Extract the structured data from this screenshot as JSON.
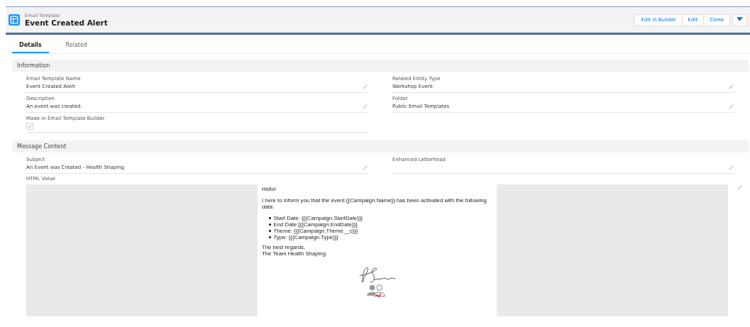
{
  "header": {
    "object_type": "Email Template",
    "title": "Event Created Alert",
    "actions": [
      "Edit in Builder",
      "Edit",
      "Clone"
    ]
  },
  "tabs": [
    {
      "label": "Details",
      "selected": true
    },
    {
      "label": "Related",
      "selected": false
    }
  ],
  "sections": [
    {
      "title": "Information",
      "fields": [
        {
          "label": "Email Template Name",
          "value": "Event Created Alert",
          "kind": "text",
          "editable": true
        },
        {
          "label": "Related Entity Type",
          "value": "Workshop Event",
          "kind": "text",
          "editable": true
        },
        {
          "label": "Description",
          "value": "An event was created.",
          "kind": "text",
          "editable": true
        },
        {
          "label": "Folder",
          "value": "Public Email Templates",
          "kind": "text",
          "editable": true
        },
        {
          "label": "Made in Email Template Builder",
          "kind": "checkbox",
          "checked": true,
          "editable": false
        }
      ]
    },
    {
      "title": "Message Content",
      "fields": [
        {
          "label": "Subject",
          "value": "An Event was Created - Health Shaping",
          "kind": "text",
          "editable": true
        },
        {
          "label": "Enhanced Letterhead",
          "kind": "text",
          "editable": true
        }
      ]
    }
  ],
  "html_value": {
    "label": "HTML Value",
    "greeting": "Hello!",
    "intro": "I here to inform you that the event {{Campaign.Name}} has been activated with the following data:",
    "items": [
      "Start Date: {{{Campaign.StartDate}}}",
      "End Date:{{{Campaign.EndDate}}}",
      "Theme: {{{Campaign.Theme__c}}}",
      "Type: {{{Campaign.Type}}}"
    ],
    "closing": [
      "The best regards,",
      "The Team Health Shaping"
    ]
  }
}
